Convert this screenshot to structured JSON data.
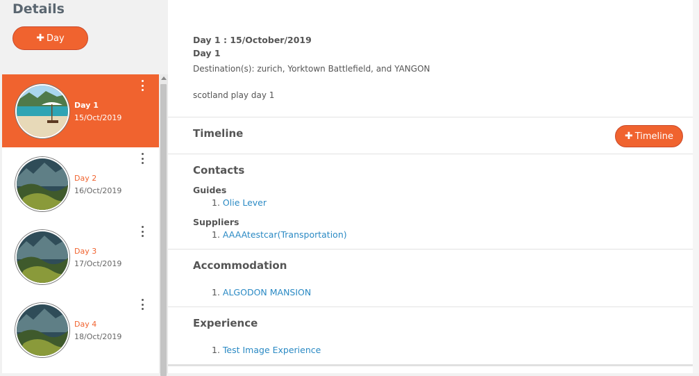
{
  "page": {
    "title": "Details"
  },
  "add_day_button": {
    "label": "Day"
  },
  "days": [
    {
      "label": "Day 1",
      "date": "15/Oct/2019",
      "image": "beach",
      "active": true
    },
    {
      "label": "Day 2",
      "date": "16/Oct/2019",
      "image": "mountain",
      "active": false
    },
    {
      "label": "Day 3",
      "date": "17/Oct/2019",
      "image": "mountain",
      "active": false
    },
    {
      "label": "Day 4",
      "date": "18/Oct/2019",
      "image": "mountain",
      "active": false
    }
  ],
  "detail": {
    "heading": "Day 1 : 15/October/2019",
    "day_name": "Day 1",
    "destinations": "Destination(s): zurich, Yorktown Battlefield, and YANGON",
    "description": "scotland play day 1",
    "timeline": {
      "title": "Timeline",
      "add_label": "Timeline"
    },
    "contacts": {
      "title": "Contacts",
      "guides_title": "Guides",
      "guides": [
        "Olie Lever"
      ],
      "suppliers_title": "Suppliers",
      "suppliers": [
        "AAAAtestcar(Transportation)"
      ]
    },
    "accommodation": {
      "title": "Accommodation",
      "items": [
        "ALGODON MANSION"
      ]
    },
    "experience": {
      "title": "Experience",
      "items": [
        "Test Image Experience"
      ]
    }
  },
  "colors": {
    "accent": "#f0632f",
    "link": "#2b8ac4",
    "text": "#555555"
  },
  "icons": {
    "kebab": "kebab-menu-icon",
    "plus": "plus-icon",
    "scroll_up": "scroll-up-arrow-icon"
  }
}
